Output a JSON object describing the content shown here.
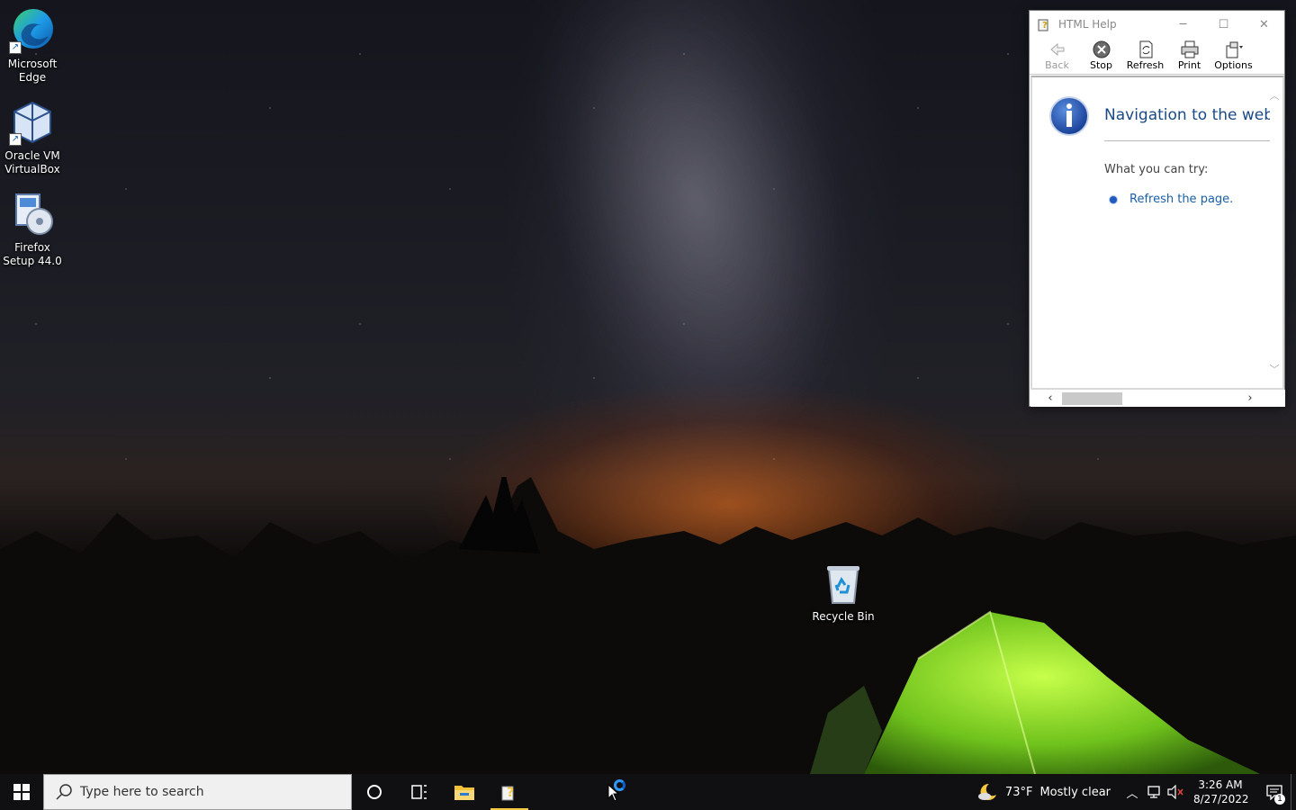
{
  "desktop": {
    "icons": [
      {
        "label": "Microsoft Edge",
        "icon": "edge-icon"
      },
      {
        "label": "Oracle VM VirtualBox",
        "icon": "virtualbox-icon"
      },
      {
        "label": "Firefox Setup 44.0",
        "icon": "installer-icon"
      },
      {
        "label": "Recycle Bin",
        "icon": "recycle-bin-icon"
      }
    ]
  },
  "help_window": {
    "title": "HTML Help",
    "controls": {
      "minimize": "─",
      "maximize": "☐",
      "close": "✕"
    },
    "toolbar": [
      {
        "label": "Back",
        "icon": "back-arrow-icon",
        "enabled": false
      },
      {
        "label": "Stop",
        "icon": "stop-icon",
        "enabled": true
      },
      {
        "label": "Refresh",
        "icon": "refresh-icon",
        "enabled": true
      },
      {
        "label": "Print",
        "icon": "printer-icon",
        "enabled": true
      },
      {
        "label": "Options",
        "icon": "options-icon",
        "enabled": true
      }
    ],
    "content": {
      "heading": "Navigation to the webpage was canceled",
      "try_label": "What you can try:",
      "suggestions": [
        "Refresh the page."
      ]
    },
    "colors": {
      "heading": "#1a4a86",
      "link": "#1a5fa8"
    }
  },
  "taskbar": {
    "search_placeholder": "Type here to search",
    "pinned": [
      {
        "name": "cortana-icon"
      },
      {
        "name": "task-view-icon"
      },
      {
        "name": "file-explorer-icon"
      },
      {
        "name": "html-help-taskbar-icon",
        "active": true
      }
    ],
    "weather": {
      "temp": "73°F",
      "condition": "Mostly clear",
      "icon": "moon-cloud-icon"
    },
    "tray_icons": [
      "chevron-up-icon",
      "network-icon",
      "volume-muted-icon"
    ],
    "time": "3:26 AM",
    "date": "8/27/2022",
    "notifications_count": "1",
    "accent": "#f5c842"
  }
}
